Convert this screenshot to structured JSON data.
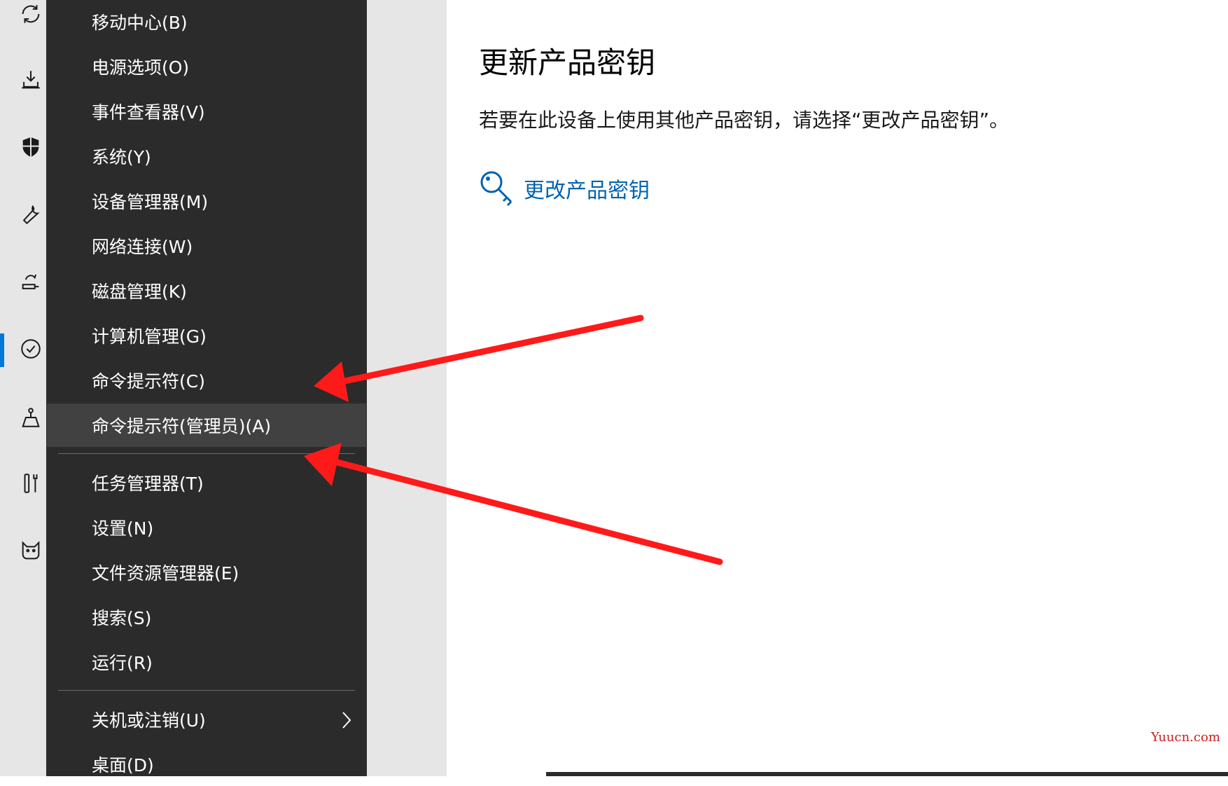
{
  "menu": {
    "items": [
      {
        "label": "移动中心(B)"
      },
      {
        "label": "电源选项(O)"
      },
      {
        "label": "事件查看器(V)"
      },
      {
        "label": "系统(Y)"
      },
      {
        "label": "设备管理器(M)"
      },
      {
        "label": "网络连接(W)"
      },
      {
        "label": "磁盘管理(K)"
      },
      {
        "label": "计算机管理(G)"
      },
      {
        "label": "命令提示符(C)"
      },
      {
        "label": "命令提示符(管理员)(A)"
      },
      {
        "label": "任务管理器(T)"
      },
      {
        "label": "设置(N)"
      },
      {
        "label": "文件资源管理器(E)"
      },
      {
        "label": "搜索(S)"
      },
      {
        "label": "运行(R)"
      },
      {
        "label": "关机或注销(U)"
      },
      {
        "label": "桌面(D)"
      }
    ],
    "hovered_item": "命令提示符(管理员)(A)"
  },
  "rail": {
    "icons": [
      "sync-icon",
      "download-icon",
      "shield-icon",
      "wrench-icon",
      "recovery-icon",
      "activation-check-icon",
      "find-device-icon",
      "developer-tools-icon",
      "insider-cat-icon"
    ],
    "active_icon": "activation-check-icon"
  },
  "main": {
    "title": "更新产品密钥",
    "description": "若要在此设备上使用其他产品密钥，请选择“更改产品密钥”。",
    "change_key_link": "更改产品密钥"
  },
  "watermark": "Yuucn.com",
  "colors": {
    "menu_bg": "#2b2b2b",
    "menu_hover": "#414141",
    "link": "#0063b1",
    "accent": "#0078d7",
    "annotation_arrow": "#ff1a1a"
  }
}
